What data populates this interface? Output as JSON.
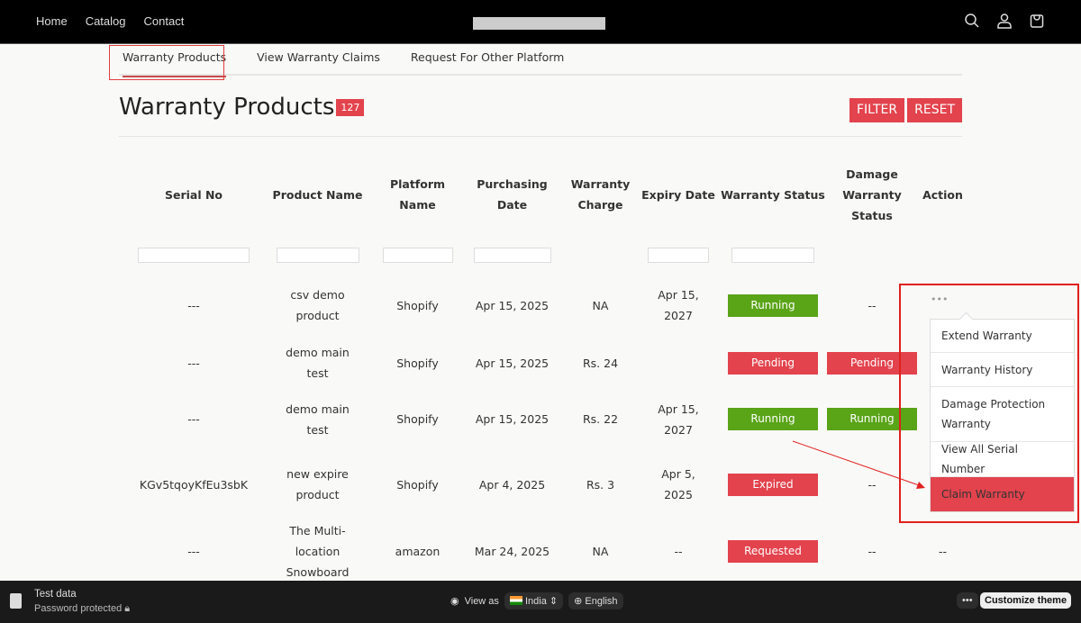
{
  "header": {
    "nav": [
      "Home",
      "Catalog",
      "Contact"
    ]
  },
  "tabs": [
    "Warranty Products",
    "View Warranty Claims",
    "Request For Other Platform"
  ],
  "page": {
    "title": "Warranty Products",
    "count": "127",
    "filter": "FILTER",
    "reset": "RESET"
  },
  "columns": [
    "Serial No",
    "Product Name",
    "Platform Name",
    "Purchasing Date",
    "Warranty Charge",
    "Expiry Date",
    "Warranty Status",
    "Damage Warranty Status",
    "Action"
  ],
  "rows": [
    {
      "serial": "---",
      "product": "csv demo product",
      "platform": "Shopify",
      "purchase": "Apr 15, 2025",
      "charge": "NA",
      "expiry": "Apr 15, 2027",
      "status": "Running",
      "damage": "--",
      "action": "..."
    },
    {
      "serial": "---",
      "product": "demo main test",
      "platform": "Shopify",
      "purchase": "Apr 15, 2025",
      "charge": "Rs. 24",
      "expiry": "",
      "status": "Pending",
      "damage": "Pending",
      "action": ""
    },
    {
      "serial": "---",
      "product": "demo main test",
      "platform": "Shopify",
      "purchase": "Apr 15, 2025",
      "charge": "Rs. 22",
      "expiry": "Apr 15, 2027",
      "status": "Running",
      "damage": "Running",
      "action": ""
    },
    {
      "serial": "KGv5tqoyKfEu3sbK",
      "product": "new expire product",
      "platform": "Shopify",
      "purchase": "Apr 4, 2025",
      "charge": "Rs. 3",
      "expiry": "Apr 5, 2025",
      "status": "Expired",
      "damage": "--",
      "action": ""
    },
    {
      "serial": "---",
      "product": "The Multi-location Snowboard",
      "platform": "amazon",
      "purchase": "Mar 24, 2025",
      "charge": "NA",
      "expiry": "--",
      "status": "Requested",
      "damage": "--",
      "action": "--"
    }
  ],
  "menu": [
    "Extend Warranty",
    "Warranty History",
    "Damage Protection Warranty",
    "View All Serial Number",
    "Claim Warranty"
  ],
  "bottom": {
    "store": "Test data",
    "protected": "Password protected",
    "view_as": "View as",
    "country": "India",
    "language": "English",
    "customize": "Customize theme"
  },
  "colors": {
    "accent": "#e2434d",
    "running": "#5aa418",
    "header": "#000000"
  }
}
